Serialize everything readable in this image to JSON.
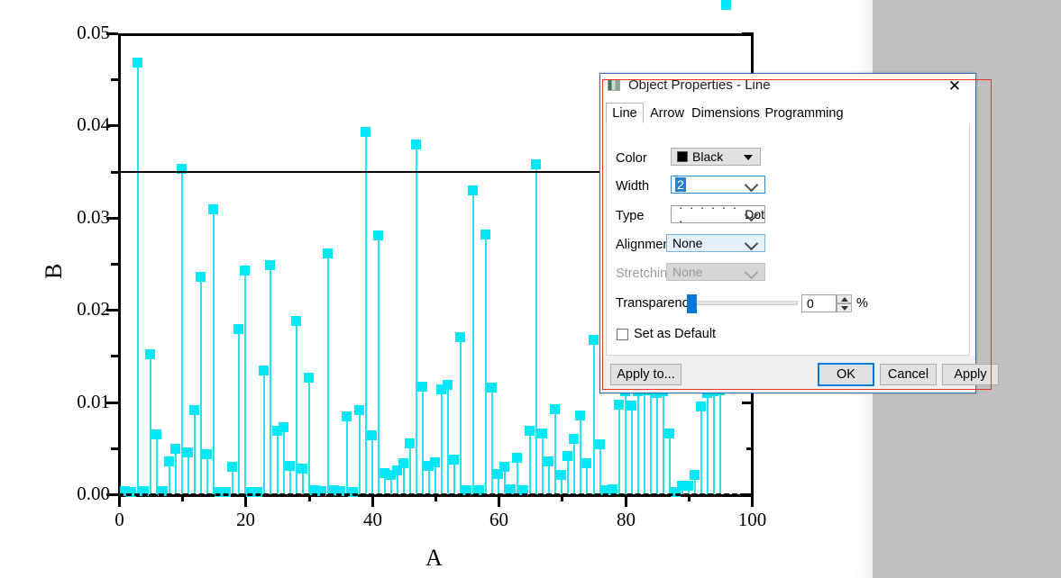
{
  "window": {
    "background_gray": "#c0c0c0"
  },
  "chart_data": {
    "type": "bar",
    "title": "",
    "xlabel": "A",
    "ylabel": "B",
    "xlim": [
      0,
      100
    ],
    "ylim": [
      0.0,
      0.05
    ],
    "x_ticks": [
      "0",
      "20",
      "40",
      "60",
      "80",
      "100"
    ],
    "x_tick_values": [
      0,
      20,
      40,
      60,
      80,
      100
    ],
    "x_minor_step": 10,
    "y_ticks": [
      "0.00",
      "0.01",
      "0.02",
      "0.03",
      "0.04",
      "0.05"
    ],
    "y_tick_values": [
      0.0,
      0.01,
      0.02,
      0.03,
      0.04,
      0.05
    ],
    "y_minor_step": 0.005,
    "grid": false,
    "legend": "none",
    "series_color": "#00e8f8",
    "marker": "square",
    "annotations": [
      {
        "name": "threshold-line",
        "type": "hline",
        "y": 0.035,
        "color": "#000000",
        "style": "solid"
      },
      {
        "name": "baseline-dashed",
        "type": "hline",
        "y": 0.0,
        "color": "#000000",
        "style": "dashed"
      }
    ],
    "x": [
      1,
      2,
      3,
      4,
      5,
      6,
      7,
      8,
      9,
      10,
      11,
      12,
      13,
      14,
      15,
      16,
      17,
      18,
      19,
      20,
      21,
      22,
      23,
      24,
      25,
      26,
      27,
      28,
      29,
      30,
      31,
      32,
      33,
      34,
      35,
      36,
      37,
      38,
      39,
      40,
      41,
      42,
      43,
      44,
      45,
      46,
      47,
      48,
      49,
      50,
      51,
      52,
      53,
      54,
      55,
      56,
      57,
      58,
      59,
      60,
      61,
      62,
      63,
      64,
      65,
      66,
      67,
      68,
      69,
      70,
      71,
      72,
      73,
      74,
      75,
      76,
      77,
      78,
      79,
      80,
      81,
      82,
      83,
      84,
      85,
      86,
      87,
      88,
      89,
      90,
      91,
      92,
      93,
      94,
      95,
      96
    ],
    "values": [
      0.0004,
      0.0003,
      0.0469,
      0.0004,
      0.0152,
      0.0065,
      0.0004,
      0.0036,
      0.005,
      0.0354,
      0.0046,
      0.0092,
      0.0236,
      0.0044,
      0.031,
      0.0003,
      0.0003,
      0.003,
      0.018,
      0.0243,
      0.0003,
      0.0003,
      0.0135,
      0.0249,
      0.0069,
      0.0073,
      0.0031,
      0.0188,
      0.0028,
      0.0127,
      0.0005,
      0.0004,
      0.0262,
      0.0005,
      0.0004,
      0.0085,
      0.0003,
      0.0092,
      0.0394,
      0.0064,
      0.0281,
      0.0023,
      0.0021,
      0.0026,
      0.0034,
      0.0056,
      0.038,
      0.0117,
      0.0031,
      0.0035,
      0.0114,
      0.0119,
      0.0038,
      0.0171,
      0.0005,
      0.033,
      0.0005,
      0.0282,
      0.0116,
      0.0022,
      0.003,
      0.0006,
      0.004,
      0.0005,
      0.0069,
      0.0358,
      0.0066,
      0.0036,
      0.0093,
      0.0021,
      0.0042,
      0.0061,
      0.0086,
      0.0034,
      0.0168,
      0.0055,
      0.0005,
      0.0006,
      0.0098,
      0.0112,
      0.0097,
      0.0112,
      0.0113,
      0.0113,
      0.011,
      0.0112,
      0.0066,
      0.0003,
      0.001,
      0.001,
      0.0021,
      0.0096,
      0.011,
      0.0112,
      0.0113
    ]
  },
  "dialog": {
    "title": "Object Properties - Line",
    "close_label": "✕",
    "tabs": [
      {
        "label": "Line",
        "selected": true
      },
      {
        "label": "Arrow",
        "selected": false
      },
      {
        "label": "Dimensions",
        "selected": false
      },
      {
        "label": "Programming",
        "selected": false
      }
    ],
    "fields": {
      "color": {
        "label": "Color",
        "value": "Black",
        "swatch": "#000000"
      },
      "width": {
        "label": "Width",
        "value": "2"
      },
      "type": {
        "label": "Type",
        "value": "Dot",
        "preview": "· · · · · · ·"
      },
      "alignment": {
        "label": "Alignment",
        "value": "None"
      },
      "stretching": {
        "label": "Stretching",
        "value": "None",
        "disabled": true
      },
      "transparency": {
        "label": "Transparency",
        "value": "0",
        "unit": "%",
        "percent": 0
      }
    },
    "set_as_default": {
      "label": "Set as Default",
      "checked": false
    },
    "buttons": {
      "apply_to": "Apply to...",
      "ok": "OK",
      "cancel": "Cancel",
      "apply": "Apply"
    }
  }
}
